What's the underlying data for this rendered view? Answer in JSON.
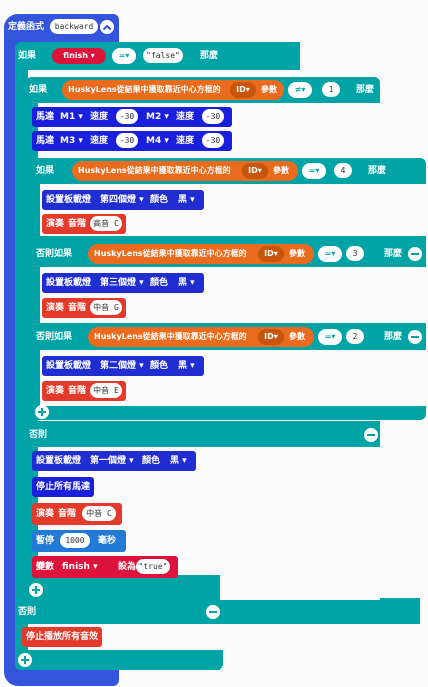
{
  "colors": {
    "function": "#3455db",
    "logic": "#00a4a6",
    "motor": "#1a1fdb",
    "music": "#e33a2c",
    "huskylens": "#ea6b1d",
    "variable": "#dc143c",
    "pause": "#217ad5"
  },
  "func": {
    "label": "定義函式",
    "name": "backward"
  },
  "if_main": {
    "if_label": "如果",
    "var": "finish",
    "op": "=",
    "value": "\"false\"",
    "then": "那麼",
    "else_label": "否則"
  },
  "inner_if": {
    "if_label": "如果",
    "husky": "HuskyLens從結果中獲取靠近中心方框的",
    "field": "ID",
    "param": "參數",
    "op": "≠",
    "value": "1",
    "then": "那麼"
  },
  "motors": [
    {
      "label": "馬達",
      "m_a": "M1",
      "speed_a": "速度",
      "val_a": "-30",
      "m_b": "M2",
      "speed_b": "速度",
      "val_b": "-30"
    },
    {
      "label": "馬達",
      "m_a": "M3",
      "speed_a": "速度",
      "val_a": "-30",
      "m_b": "M4",
      "speed_b": "速度",
      "val_b": "-30"
    }
  ],
  "nested_if": {
    "if_label": "如果",
    "elseif_label": "否則如果",
    "then": "那麼",
    "husky": "HuskyLens從結果中獲取靠近中心方框的",
    "field": "ID",
    "param": "參數",
    "op": "=",
    "branches": [
      {
        "value": "4",
        "light": "設置板載燈",
        "which": "第四個燈",
        "color_label": "顏色",
        "color": "黑",
        "play": "演奏",
        "tone": "音階",
        "note": "高音 C"
      },
      {
        "value": "3",
        "light": "設置板載燈",
        "which": "第三個燈",
        "color_label": "顏色",
        "color": "黑",
        "play": "演奏",
        "tone": "音階",
        "note": "中音 G"
      },
      {
        "value": "2",
        "light": "設置板載燈",
        "which": "第二個燈",
        "color_label": "顏色",
        "color": "黑",
        "play": "演奏",
        "tone": "音階",
        "note": "中音 E"
      }
    ]
  },
  "inner_else": {
    "label": "否則",
    "light": "設置板載燈",
    "which": "第一個燈",
    "color_label": "顏色",
    "color": "黑",
    "stop_motors": "停止所有馬達",
    "play": "演奏",
    "tone": "音階",
    "note": "中音 C",
    "pause": "暫停",
    "pause_ms": "1000",
    "pause_unit": "毫秒",
    "set_var": "變數",
    "var": "finish",
    "set_to": "設為",
    "var_value": "\"true\""
  },
  "outer_else": {
    "label": "否則",
    "stop_sound": "停止播放所有音效"
  }
}
